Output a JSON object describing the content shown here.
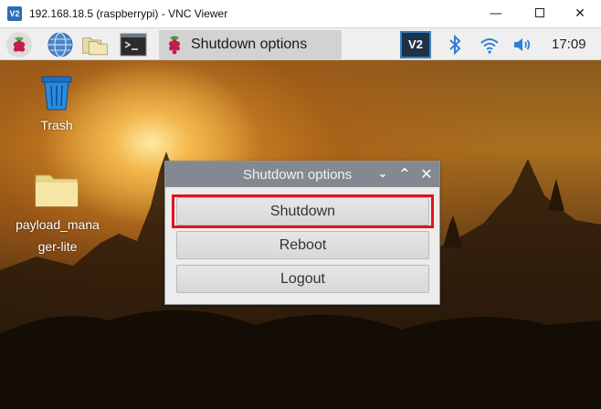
{
  "window": {
    "logo_text": "V2",
    "title": "192.168.18.5 (raspberrypi) - VNC Viewer",
    "minimize": "—",
    "close": "✕"
  },
  "taskbar": {
    "launchers": [
      "raspberry-menu-icon",
      "web-browser-icon",
      "file-manager-icon",
      "terminal-icon"
    ],
    "active_task": {
      "icon": "raspberry-icon",
      "label": "Shutdown options"
    },
    "tray": {
      "vnc_label": "V2",
      "icons": [
        "bluetooth-icon",
        "wifi-icon",
        "volume-icon"
      ],
      "clock": "17:09"
    }
  },
  "desktop": {
    "icons": [
      {
        "name": "trash",
        "label": "Trash",
        "icon": "trash-icon"
      },
      {
        "name": "payload-folder",
        "label_line1": "payload_mana",
        "label_line2": "ger-lite",
        "icon": "folder-icon"
      }
    ]
  },
  "dialog": {
    "title": "Shutdown options",
    "controls": {
      "down": "⌄",
      "up": "^",
      "close": "✕"
    },
    "buttons": [
      {
        "label": "Shutdown",
        "highlighted": true
      },
      {
        "label": "Reboot"
      },
      {
        "label": "Logout"
      }
    ],
    "highlight_color": "#e0141e"
  },
  "colors": {
    "taskbar_bg": "#efefef",
    "dialog_titlebar": "#828990",
    "vnc_accent": "#3580c7"
  }
}
